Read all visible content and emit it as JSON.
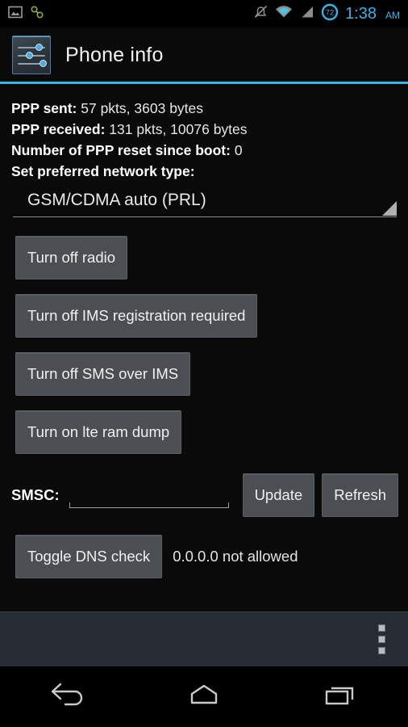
{
  "statusbar": {
    "icons": [
      "screenshot-icon",
      "usb-connection-icon",
      "ringer-muted-icon",
      "wifi-icon",
      "cell-signal-icon",
      "battery-icon"
    ],
    "battery_level": "72",
    "time": "1:38",
    "ampm": "AM",
    "accent_color": "#33b5e5"
  },
  "actionbar": {
    "app_icon": "sliders-settings-icon",
    "title": "Phone info",
    "divider_color": "#33b5e5"
  },
  "info": {
    "ppp_sent_label": "PPP sent:",
    "ppp_sent_value": "57 pkts, 3603 bytes",
    "ppp_received_label": "PPP received:",
    "ppp_received_value": "131 pkts, 10076 bytes",
    "ppp_reset_label": "Number of PPP reset since boot:",
    "ppp_reset_value": "0",
    "network_type_label": "Set preferred network type:"
  },
  "network_spinner": {
    "selected": "GSM/CDMA auto (PRL)",
    "arrow": "dropdown-triangle-icon"
  },
  "toggles": [
    {
      "label": "Turn off radio"
    },
    {
      "label": "Turn off IMS registration required"
    },
    {
      "label": "Turn off SMS over IMS"
    },
    {
      "label": "Turn on lte ram dump"
    }
  ],
  "smsc": {
    "label": "SMSC:",
    "value": "",
    "placeholder": "",
    "update_label": "Update",
    "refresh_label": "Refresh"
  },
  "dns": {
    "toggle_label": "Toggle DNS check",
    "status": "0.0.0.0 not allowed"
  },
  "bottombar": {
    "overflow_label": "overflow-menu-icon"
  },
  "navbar": {
    "back": "back-icon",
    "home": "home-icon",
    "recents": "recents-icon"
  },
  "colors": {
    "background": "#0a0a0a",
    "button": "#4b4f53",
    "bottombar": "#282c35"
  }
}
